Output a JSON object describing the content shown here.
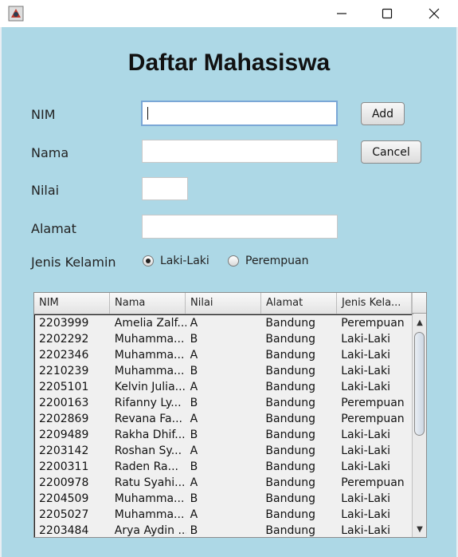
{
  "window": {
    "title": ""
  },
  "form": {
    "title": "Daftar Mahasiswa",
    "nim_label": "NIM",
    "nama_label": "Nama",
    "nilai_label": "Nilai",
    "alamat_label": "Alamat",
    "jenis_kelamin_label": "Jenis Kelamin",
    "nim_value": "",
    "nama_value": "",
    "nilai_value": "",
    "alamat_value": "",
    "add_label": "Add",
    "cancel_label": "Cancel",
    "radio_laki": "Laki-Laki",
    "radio_perempuan": "Perempuan",
    "selected_gender": "Laki-Laki"
  },
  "table": {
    "columns": [
      "NIM",
      "Nama",
      "Nilai",
      "Alamat",
      "Jenis Kela..."
    ],
    "rows": [
      [
        "2203999",
        "Amelia Zalf...",
        "A",
        "Bandung",
        "Perempuan"
      ],
      [
        "2202292",
        "Muhamma...",
        "B",
        "Bandung",
        "Laki-Laki"
      ],
      [
        "2202346",
        "Muhamma...",
        "A",
        "Bandung",
        "Laki-Laki"
      ],
      [
        "2210239",
        "Muhamma...",
        "B",
        "Bandung",
        "Laki-Laki"
      ],
      [
        "2205101",
        "Kelvin Julia...",
        "A",
        "Bandung",
        "Laki-Laki"
      ],
      [
        "2200163",
        "Rifanny Ly...",
        "B",
        "Bandung",
        "Perempuan"
      ],
      [
        "2202869",
        "Revana Fa...",
        "A",
        "Bandung",
        "Perempuan"
      ],
      [
        "2209489",
        "Rakha Dhif...",
        "B",
        "Bandung",
        "Laki-Laki"
      ],
      [
        "2203142",
        "Roshan Sy...",
        "A",
        "Bandung",
        "Laki-Laki"
      ],
      [
        "2200311",
        "Raden Ra...",
        "B",
        "Bandung",
        "Laki-Laki"
      ],
      [
        "2200978",
        "Ratu Syahi...",
        "A",
        "Bandung",
        "Perempuan"
      ],
      [
        "2204509",
        "Muhamma...",
        "B",
        "Bandung",
        "Laki-Laki"
      ],
      [
        "2205027",
        "Muhamma...",
        "A",
        "Bandung",
        "Laki-Laki"
      ],
      [
        "2203484",
        "Arya Aydin ...",
        "B",
        "Bandung",
        "Laki-Laki"
      ]
    ]
  },
  "icons": {
    "app": "java-app-icon",
    "minimize": "minimize-icon",
    "maximize": "maximize-icon",
    "close": "close-icon"
  },
  "colors": {
    "background": "#add8e6",
    "titlebar": "#ffffff"
  }
}
